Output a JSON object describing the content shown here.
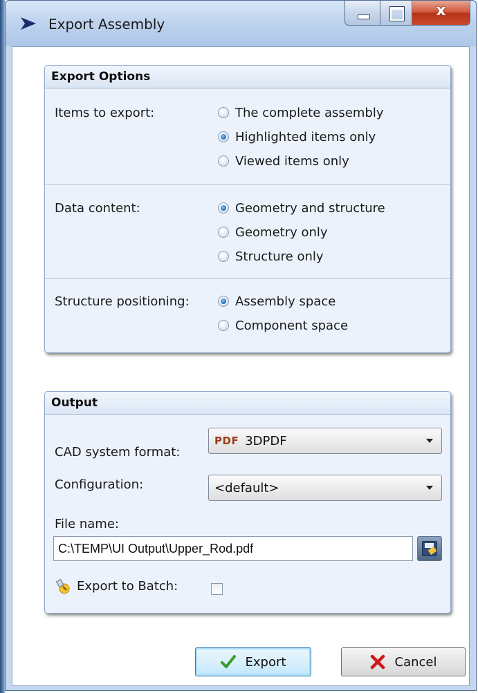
{
  "window": {
    "title": "Export Assembly",
    "app_icon": "arrow-chevron-icon",
    "controls": {
      "minimize": "minimize-icon",
      "maximize": "maximize-icon",
      "close": "close-icon",
      "close_glyph": "x"
    }
  },
  "export_options": {
    "header": "Export Options",
    "items_to_export": {
      "label": "Items to export:",
      "options": [
        "The complete assembly",
        "Highlighted items only",
        "Viewed items only"
      ],
      "selected": "Highlighted items only"
    },
    "data_content": {
      "label": "Data content:",
      "options": [
        "Geometry and structure",
        "Geometry only",
        "Structure only"
      ],
      "selected": "Geometry and structure"
    },
    "structure_positioning": {
      "label": "Structure positioning:",
      "options": [
        "Assembly space",
        "Component space"
      ],
      "selected": "Assembly space"
    }
  },
  "output": {
    "header": "Output",
    "cad_format": {
      "label": "CAD system format:",
      "badge": "PDF",
      "value": "3DPDF"
    },
    "configuration": {
      "label": "Configuration:",
      "value": "<default>"
    },
    "file_name": {
      "label": "File name:",
      "value": "C:\\TEMP\\UI Output\\Upper_Rod.pdf"
    },
    "export_to_batch": {
      "label": "Export to Batch:",
      "checked": false
    }
  },
  "buttons": {
    "export": "Export",
    "cancel": "Cancel"
  }
}
